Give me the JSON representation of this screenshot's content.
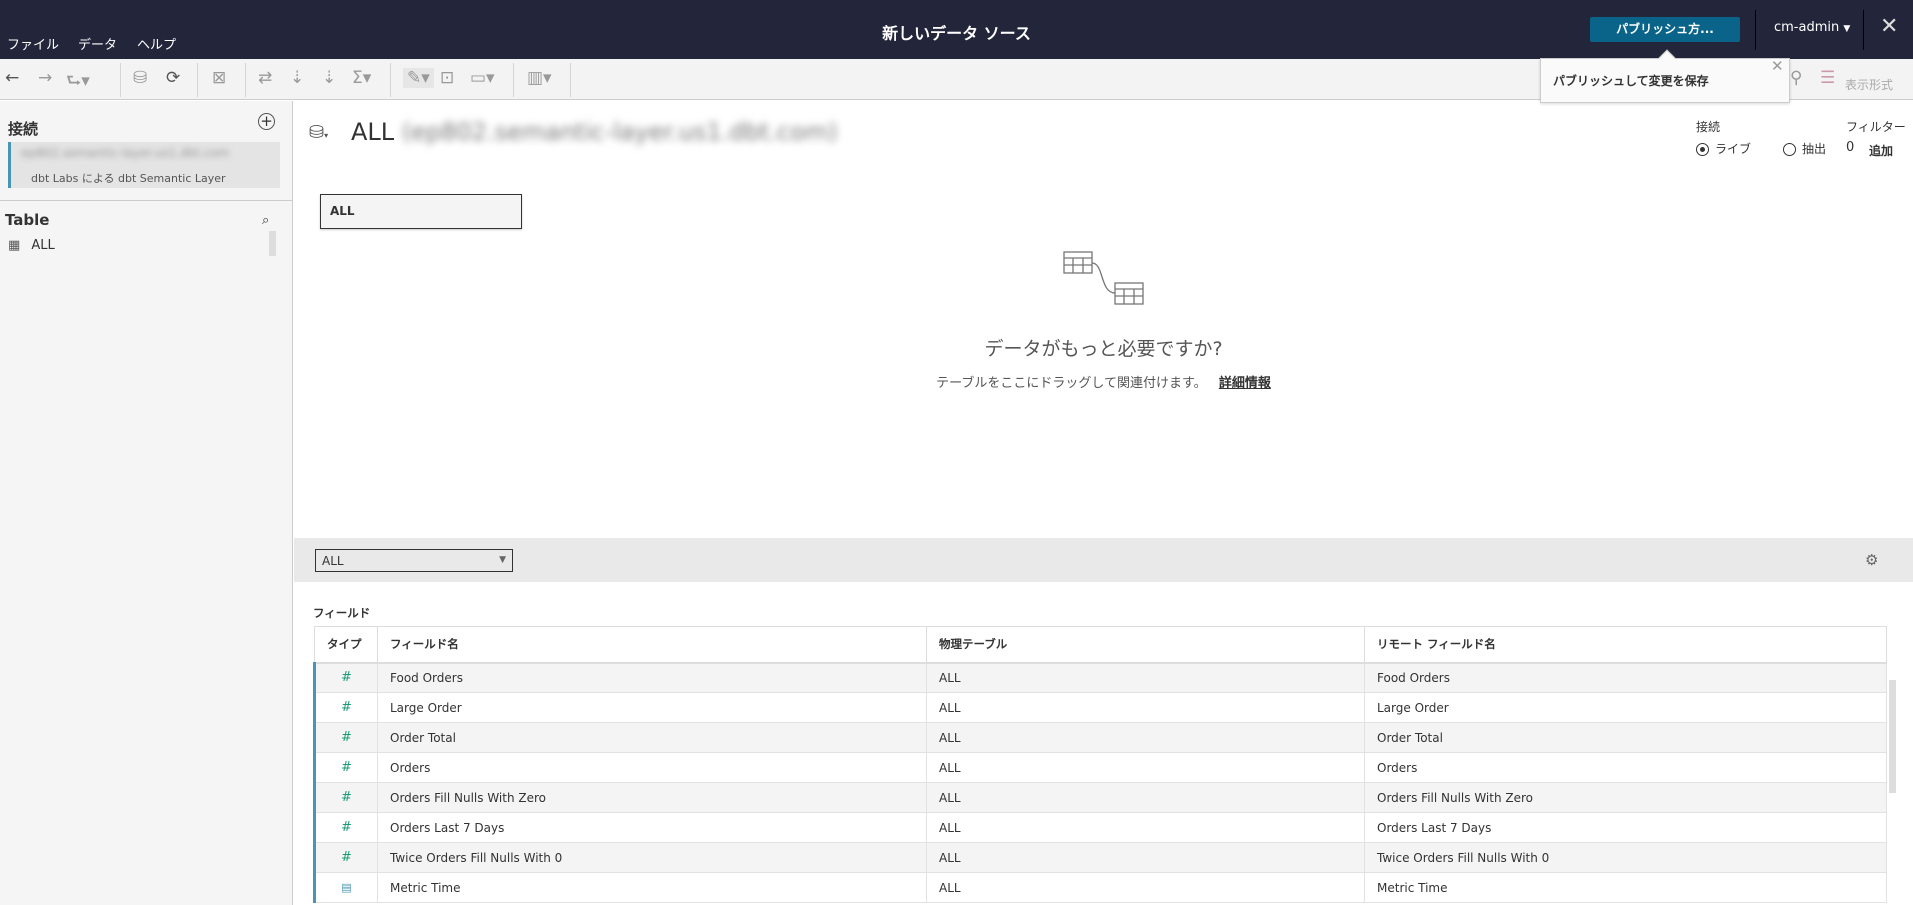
{
  "app": {
    "title": "新しいデータ ソース",
    "menu": [
      "ファイル",
      "データ",
      "ヘルプ"
    ],
    "publish_label": "パブリッシュ方...",
    "user": "cm-admin",
    "close": "✕"
  },
  "toolbar": {
    "format_label": "表示形式"
  },
  "tooltip": {
    "text": "パブリッシュして変更を保存",
    "close": "✕"
  },
  "left": {
    "connections_title": "接続",
    "connection_name": "ep802.semantic-layer.us1.dbt.com",
    "connection_sub": "dbt Labs による dbt Semantic Layer",
    "table_title": "Table",
    "tables": [
      "ALL"
    ]
  },
  "canvas": {
    "title": "ALL",
    "title_host": "(ep802.semantic-layer.us1.dbt.com)",
    "table_box": "ALL",
    "empty_title": "データがもっと必要ですか?",
    "empty_sub": "テーブルをここにドラッグして関連付けます。",
    "learn_more": "詳細情報"
  },
  "connection_opts": {
    "label": "接続",
    "live": "ライブ",
    "extract": "抽出",
    "selected": "live",
    "filter_label": "フィルター",
    "filter_count": "0",
    "filter_add": "追加"
  },
  "grid": {
    "table_select": "ALL",
    "section": "フィールド",
    "columns": [
      "タイプ",
      "フィールド名",
      "物理テーブル",
      "リモート フィールド名"
    ],
    "rows": [
      {
        "type": "#",
        "name": "Food Orders",
        "table": "ALL",
        "remote": "Food Orders"
      },
      {
        "type": "#",
        "name": "Large Order",
        "table": "ALL",
        "remote": "Large Order"
      },
      {
        "type": "#",
        "name": "Order Total",
        "table": "ALL",
        "remote": "Order Total"
      },
      {
        "type": "#",
        "name": "Orders",
        "table": "ALL",
        "remote": "Orders"
      },
      {
        "type": "#",
        "name": "Orders Fill Nulls With Zero",
        "table": "ALL",
        "remote": "Orders Fill Nulls With Zero"
      },
      {
        "type": "#",
        "name": "Orders Last 7 Days",
        "table": "ALL",
        "remote": "Orders Last 7 Days"
      },
      {
        "type": "#",
        "name": "Twice Orders Fill Nulls With 0",
        "table": "ALL",
        "remote": "Twice Orders Fill Nulls With 0"
      },
      {
        "type": "date",
        "name": "Metric Time",
        "table": "ALL",
        "remote": "Metric Time"
      }
    ]
  }
}
